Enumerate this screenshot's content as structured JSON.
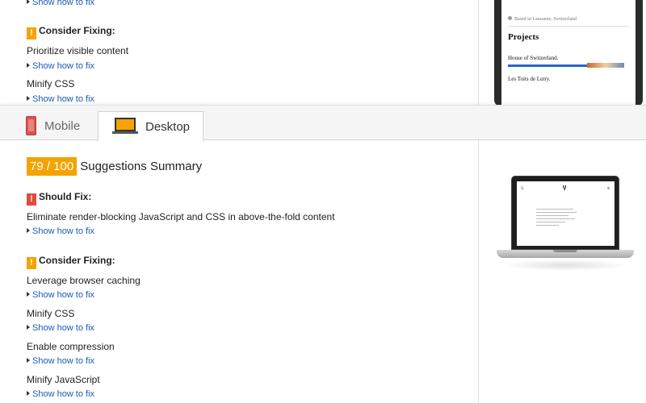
{
  "mobile": {
    "links": {
      "top_show_fix": "Show how to fix",
      "prioritize_show_fix": "Show how to fix",
      "minify_css_show_fix": "Show how to fix"
    },
    "consider_heading": "Consider Fixing:",
    "rules": {
      "prioritize": "Prioritize visible content",
      "minify_css": "Minify CSS"
    },
    "preview": {
      "location": "Based in Lausanne, Switzerland",
      "projects": "Projects",
      "project_1": "House of Switzerland.",
      "project_2": "Les Toits de Lutry."
    }
  },
  "tabs": [
    {
      "label": "Mobile",
      "active": false
    },
    {
      "label": "Desktop",
      "active": true
    }
  ],
  "desktop": {
    "score": "79 / 100",
    "summary_title": "Suggestions Summary",
    "should_fix_heading": "Should Fix:",
    "consider_heading": "Consider Fixing:",
    "should_fix": [
      {
        "title": "Eliminate render-blocking JavaScript and CSS in above-the-fold content",
        "link": "Show how to fix"
      }
    ],
    "consider": [
      {
        "title": "Leverage browser caching",
        "link": "Show how to fix"
      },
      {
        "title": "Minify CSS",
        "link": "Show how to fix"
      },
      {
        "title": "Enable compression",
        "link": "Show how to fix"
      },
      {
        "title": "Minify JavaScript",
        "link": "Show how to fix"
      }
    ],
    "preview": {
      "logo": "Ⴤ",
      "left_glyph": "L",
      "menu_glyph": "≡"
    }
  },
  "colors": {
    "warning": "#f4a400",
    "error": "#de4b3c",
    "link": "#1a5bb8"
  },
  "icons": {
    "warning": "!",
    "triangle": "triangle-right-icon"
  }
}
